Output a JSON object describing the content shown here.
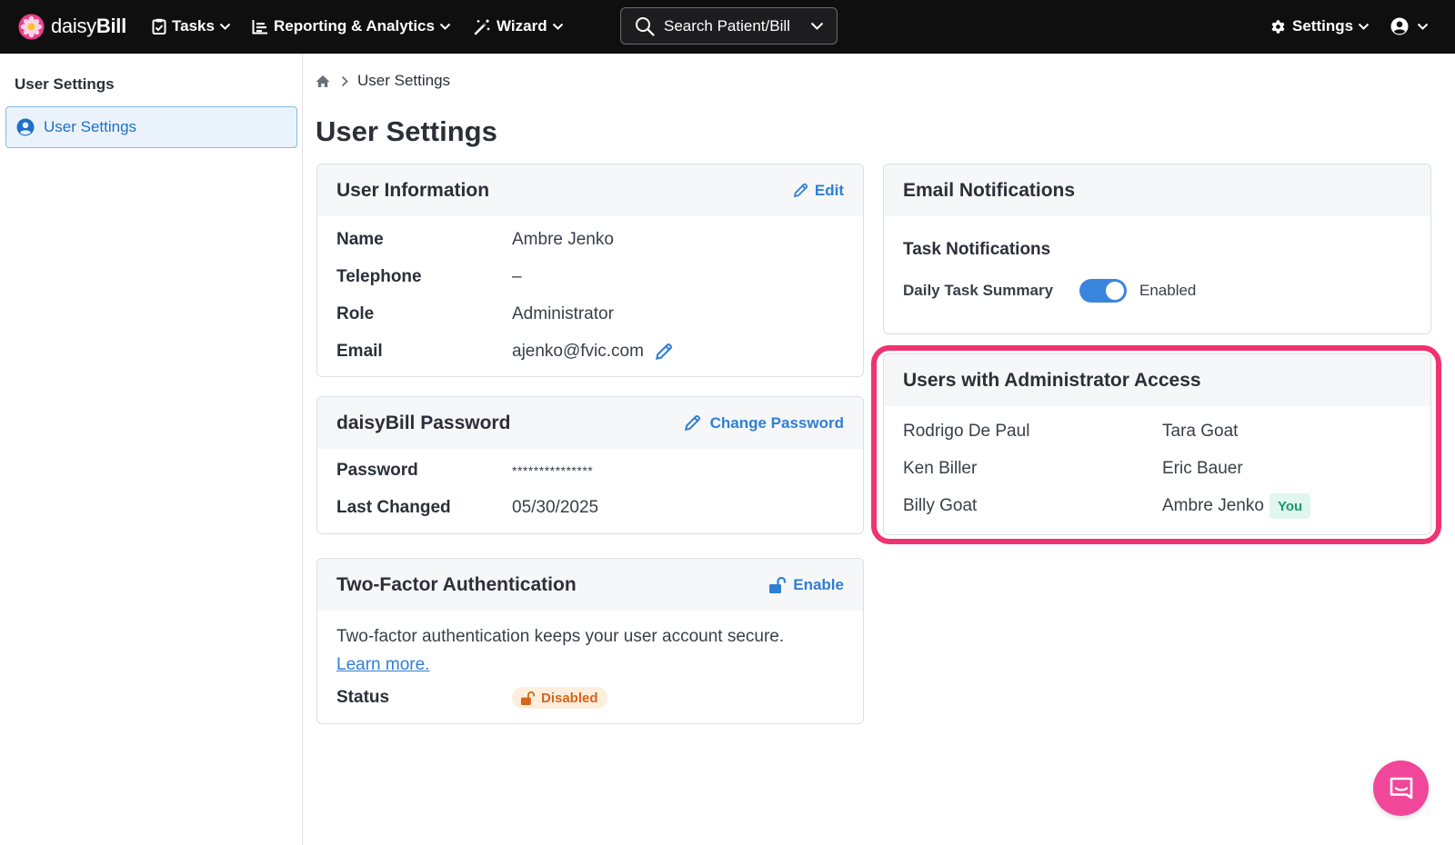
{
  "brand": {
    "name_light": "daisy",
    "name_bold": "Bill"
  },
  "nav": {
    "tasks": "Tasks",
    "reporting": "Reporting & Analytics",
    "wizard": "Wizard",
    "search_label": "Search Patient/Bill",
    "settings": "Settings"
  },
  "sidebar": {
    "heading": "User Settings",
    "items": [
      {
        "label": "User Settings",
        "active": true
      }
    ]
  },
  "breadcrumb": {
    "current": "User Settings"
  },
  "page_title": "User Settings",
  "user_info": {
    "title": "User Information",
    "edit_label": "Edit",
    "fields": [
      {
        "label": "Name",
        "value": "Ambre Jenko"
      },
      {
        "label": "Telephone",
        "value": "–"
      },
      {
        "label": "Role",
        "value": "Administrator"
      },
      {
        "label": "Email",
        "value": "ajenko@fvic.com"
      }
    ]
  },
  "password": {
    "title": "daisyBill Password",
    "change_label": "Change Password",
    "fields": [
      {
        "label": "Password",
        "value": "***************"
      },
      {
        "label": "Last Changed",
        "value": "05/30/2025"
      }
    ]
  },
  "two_factor": {
    "title": "Two-Factor Authentication",
    "enable_label": "Enable",
    "description": "Two-factor authentication keeps your user account secure.",
    "learn_more": "Learn more.",
    "status_label": "Status",
    "status_value": "Disabled"
  },
  "email_notifications": {
    "title": "Email Notifications",
    "subheading": "Task Notifications",
    "toggle_label": "Daily Task Summary",
    "toggle_enabled": true,
    "toggle_state": "Enabled"
  },
  "admins": {
    "title": "Users with Administrator Access",
    "users": [
      {
        "name": "Rodrigo De Paul"
      },
      {
        "name": "Tara Goat"
      },
      {
        "name": "Ken Biller"
      },
      {
        "name": "Eric Bauer"
      },
      {
        "name": "Billy Goat"
      },
      {
        "name": "Ambre Jenko",
        "badge": "You"
      }
    ]
  },
  "colors": {
    "accent": "#2f7fd6",
    "highlight": "#f0336f",
    "chat": "#f0479a",
    "disabled_badge": "#d8651a",
    "you_badge": "#1b9a6a"
  }
}
